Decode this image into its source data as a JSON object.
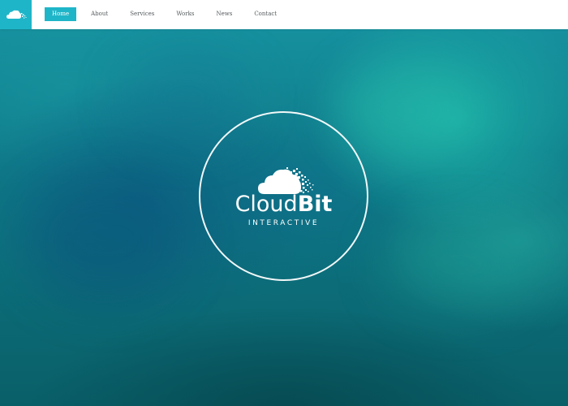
{
  "header": {
    "logo_icon": "cloud-pixel-icon",
    "nav": [
      {
        "label": "Home",
        "active": true
      },
      {
        "label": "About",
        "active": false
      },
      {
        "label": "Services",
        "active": false
      },
      {
        "label": "Works",
        "active": false
      },
      {
        "label": "News",
        "active": false
      },
      {
        "label": "Contact",
        "active": false
      }
    ]
  },
  "hero": {
    "logo_icon": "cloud-pixel-icon",
    "brand_name_first": "Cloud",
    "brand_name_second": "Bit",
    "brand_tagline": "INTERACTIVE"
  },
  "colors": {
    "accent": "#1fb5c8",
    "header_bg": "#ffffff",
    "nav_text": "#555b5e",
    "hero_primary": "#0e7684",
    "hero_highlight": "#1cb2a8",
    "ring": "#ffffff"
  }
}
